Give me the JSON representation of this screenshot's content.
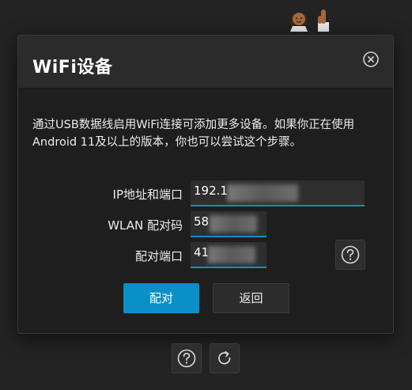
{
  "dialog": {
    "title": "WiFi设备",
    "description": "通过USB数据线启用WiFi连接可添加更多设备。如果你正在使用Android 11及以上的版本，你也可以尝试这个步骤。",
    "close_icon": "close-circle-icon"
  },
  "form": {
    "ip_label": "IP地址和端口",
    "ip_value": "192.1",
    "wlan_label": "WLAN 配对码",
    "wlan_value": "58",
    "port_label": "配对端口",
    "port_value": "41",
    "help_icon": "question-circle-icon"
  },
  "actions": {
    "pair_label": "配对",
    "back_label": "返回"
  },
  "footer": {
    "help_icon": "question-circle-icon",
    "refresh_icon": "refresh-icon"
  },
  "colors": {
    "accent": "#0a8fc7",
    "dialog_bg": "#1e1e1e",
    "header_bg": "#2b2b2b",
    "page_bg": "#232323"
  }
}
